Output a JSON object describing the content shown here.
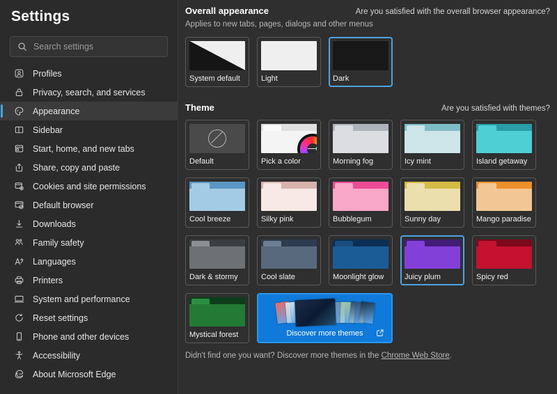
{
  "sidebar": {
    "title": "Settings",
    "search": {
      "placeholder": "Search settings",
      "value": "",
      "icon": "search-icon"
    },
    "items": [
      {
        "label": "Profiles",
        "icon": "profile-icon",
        "active": false
      },
      {
        "label": "Privacy, search, and services",
        "icon": "lock-icon",
        "active": false
      },
      {
        "label": "Appearance",
        "icon": "palette-icon",
        "active": true
      },
      {
        "label": "Sidebar",
        "icon": "sidebar-icon",
        "active": false
      },
      {
        "label": "Start, home, and new tabs",
        "icon": "window-icon",
        "active": false
      },
      {
        "label": "Share, copy and paste",
        "icon": "share-icon",
        "active": false
      },
      {
        "label": "Cookies and site permissions",
        "icon": "cookies-icon",
        "active": false
      },
      {
        "label": "Default browser",
        "icon": "default-browser-icon",
        "active": false
      },
      {
        "label": "Downloads",
        "icon": "download-icon",
        "active": false
      },
      {
        "label": "Family safety",
        "icon": "family-icon",
        "active": false
      },
      {
        "label": "Languages",
        "icon": "language-icon",
        "active": false
      },
      {
        "label": "Printers",
        "icon": "printer-icon",
        "active": false
      },
      {
        "label": "System and performance",
        "icon": "monitor-icon",
        "active": false
      },
      {
        "label": "Reset settings",
        "icon": "reset-icon",
        "active": false
      },
      {
        "label": "Phone and other devices",
        "icon": "phone-icon",
        "active": false
      },
      {
        "label": "Accessibility",
        "icon": "accessibility-icon",
        "active": false
      },
      {
        "label": "About Microsoft Edge",
        "icon": "edge-icon",
        "active": false
      }
    ]
  },
  "appearance": {
    "title": "Overall appearance",
    "feedback_link": "Are you satisfied with the overall browser appearance?",
    "subtitle": "Applies to new tabs, pages, dialogs and other menus",
    "options": [
      {
        "label": "System default",
        "selected": false,
        "preview": "system"
      },
      {
        "label": "Light",
        "selected": false,
        "preview": "light"
      },
      {
        "label": "Dark",
        "selected": true,
        "preview": "dark"
      }
    ]
  },
  "theme": {
    "title": "Theme",
    "feedback_link": "Are you satisfied with themes?",
    "tiles": [
      {
        "label": "Default",
        "kind": "default",
        "selected": false
      },
      {
        "label": "Pick a color",
        "kind": "picker",
        "selected": false,
        "body": "#f4f4f4",
        "bar": "#e0e0e0",
        "tab": "#fbfbfb"
      },
      {
        "label": "Morning fog",
        "kind": "folder",
        "selected": false,
        "body": "#dcdde1",
        "bar": "#aeb3bb",
        "tab": "#dcdde1"
      },
      {
        "label": "Icy mint",
        "kind": "folder",
        "selected": false,
        "body": "#cde4e8",
        "bar": "#7dbdc6",
        "tab": "#cde4e8"
      },
      {
        "label": "Island getaway",
        "kind": "folder",
        "selected": false,
        "body": "#4ecfd4",
        "bar": "#2a9da6",
        "tab": "#4ecfd4"
      },
      {
        "label": "Cool breeze",
        "kind": "folder",
        "selected": false,
        "body": "#a4cbe5",
        "bar": "#5a97c4",
        "tab": "#a4cbe5"
      },
      {
        "label": "Silky pink",
        "kind": "folder",
        "selected": false,
        "body": "#f6e9e6",
        "bar": "#d8b3ad",
        "tab": "#f6e9e6"
      },
      {
        "label": "Bubblegum",
        "kind": "folder",
        "selected": false,
        "body": "#f9a7c6",
        "bar": "#ee4b96",
        "tab": "#f9a7c6"
      },
      {
        "label": "Sunny day",
        "kind": "folder",
        "selected": false,
        "body": "#ebdfae",
        "bar": "#d4bb45",
        "tab": "#ebdfae"
      },
      {
        "label": "Mango paradise",
        "kind": "folder",
        "selected": false,
        "body": "#f2c795",
        "bar": "#ef8f29",
        "tab": "#f2c795"
      },
      {
        "label": "Dark & stormy",
        "kind": "folder",
        "selected": false,
        "body": "#6e7173",
        "bar": "#3b3e40",
        "tab": "#8d9092"
      },
      {
        "label": "Cool slate",
        "kind": "folder",
        "selected": false,
        "body": "#58697e",
        "bar": "#2e3c4f",
        "tab": "#6c7e93"
      },
      {
        "label": "Moonlight glow",
        "kind": "folder",
        "selected": false,
        "body": "#1b5c97",
        "bar": "#0c2f53",
        "tab": "#1b4c7e"
      },
      {
        "label": "Juicy plum",
        "kind": "folder",
        "selected": true,
        "body": "#8340d8",
        "bar": "#431d78",
        "tab": "#8340d8"
      },
      {
        "label": "Spicy red",
        "kind": "folder",
        "selected": false,
        "body": "#c41230",
        "bar": "#7c0a1c",
        "tab": "#c41230"
      },
      {
        "label": "Mystical forest",
        "kind": "folder",
        "selected": false,
        "body": "#237a35",
        "bar": "#0e3d1c",
        "tab": "#2b8f3f"
      }
    ],
    "discover": {
      "label": "Discover more themes",
      "icon": "external-link-icon",
      "accent": "#0f7ada",
      "fan_colors": [
        "#e86a6a",
        "#cfe3ee",
        "#1b2c4a",
        "#6a8fb5",
        "#9fc4a0",
        "#2a4a6e",
        "#17334f"
      ]
    },
    "footnote_prefix": "Didn't find one you want? Discover more themes in the ",
    "footnote_link": "Chrome Web Store",
    "footnote_suffix": "."
  }
}
